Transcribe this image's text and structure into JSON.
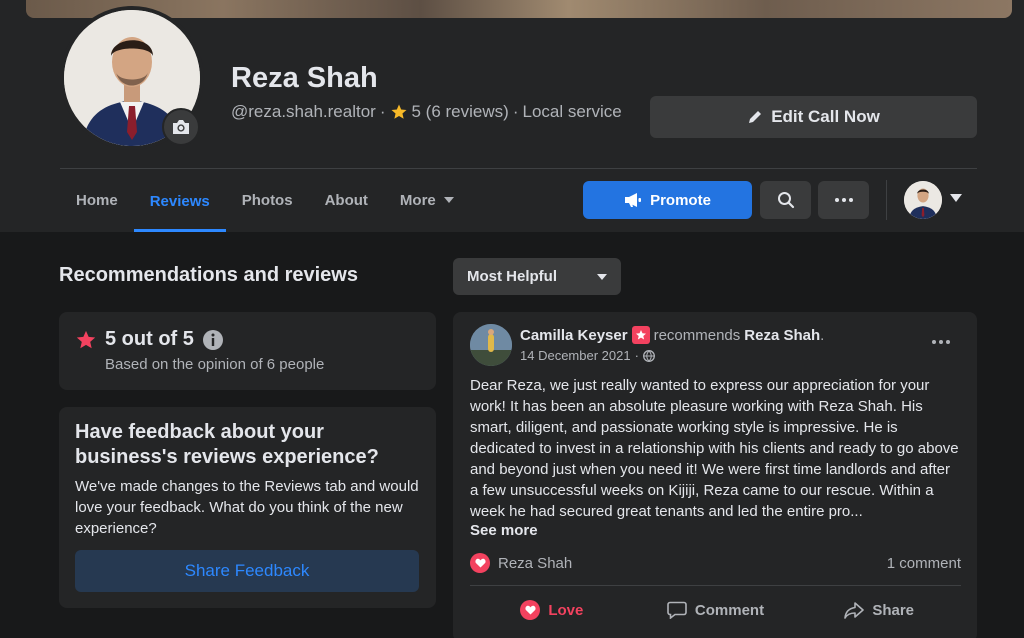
{
  "profile": {
    "name": "Reza Shah",
    "handle": "@reza.shah.realtor",
    "separator": "·",
    "rating_text": "5 (6 reviews)",
    "category": "Local service",
    "edit_button": "Edit Call Now"
  },
  "nav": {
    "tabs": [
      {
        "label": "Home"
      },
      {
        "label": "Reviews"
      },
      {
        "label": "Photos"
      },
      {
        "label": "About"
      },
      {
        "label": "More"
      }
    ],
    "promote_label": "Promote"
  },
  "reviews_section": {
    "title": "Recommendations and reviews",
    "sort_label": "Most Helpful",
    "rating_summary": "5 out of 5",
    "rating_basis": "Based on the opinion of 6 people"
  },
  "feedback": {
    "title": "Have feedback about your business's reviews experience?",
    "body": "We've made changes to the Reviews tab and would love your feedback. What do you think of the new experience?",
    "button": "Share Feedback"
  },
  "review": {
    "author": "Camilla Keyser",
    "verb": "recommends",
    "target": "Reza Shah",
    "period": ".",
    "date": "14 December 2021",
    "dot": "·",
    "text": "Dear Reza, we just really wanted to express our appreciation for your work! It has been an absolute pleasure working with Reza Shah. His smart, diligent, and passionate working style is impressive. He is dedicated to invest in a relationship with his clients and ready to go above and beyond just when you need it! We were first time landlords and after a few unsuccessful weeks on Kijiji, Reza came to our rescue. Within a week he had secured great tenants and led the entire pro...",
    "see_more": "See more",
    "reactor": "Reza Shah",
    "comments": "1 comment",
    "actions": {
      "love": "Love",
      "comment": "Comment",
      "share": "Share"
    }
  },
  "colors": {
    "accent": "#2d88ff",
    "promote": "#2374e1",
    "love": "#f3425f",
    "star": "#f7b928"
  },
  "icons": [
    "camera-icon",
    "pencil-icon",
    "star-icon",
    "caret-down-icon",
    "megaphone-icon",
    "search-icon",
    "more-icon",
    "info-icon",
    "globe-icon",
    "heart-icon",
    "comment-icon",
    "share-icon",
    "recommend-badge-icon"
  ]
}
